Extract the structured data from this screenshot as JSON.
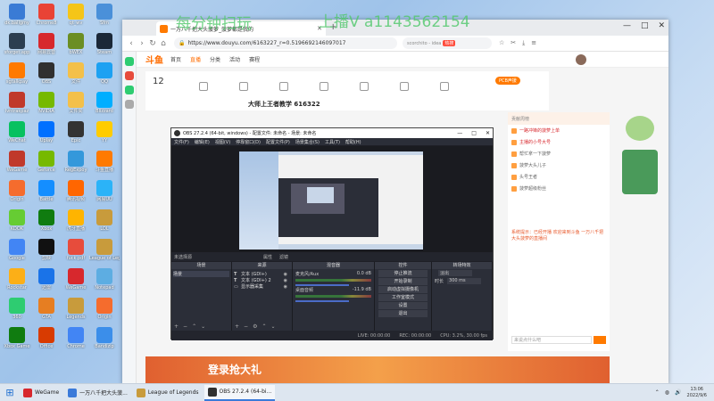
{
  "overlay": {
    "text_left": "每分钟扫玩",
    "text_right": "上播V a1143562154"
  },
  "desktop_icons": [
    {
      "label": "dk.ballgmy",
      "color": "#3a7bd5"
    },
    {
      "label": "Chrome8",
      "color": "#e94335"
    },
    {
      "label": "qt_wv",
      "color": "#f5c518"
    },
    {
      "label": "Sfm",
      "color": "#4a90d9"
    },
    {
      "label": "sforget.app",
      "color": "#2c3e50"
    },
    {
      "label": "网易云音",
      "color": "#d7282d"
    },
    {
      "label": "bWEX",
      "color": "#6b8e23"
    },
    {
      "label": "Steam",
      "color": "#1b2838"
    },
    {
      "label": "sgtalkpay",
      "color": "#ff7a00"
    },
    {
      "label": "OBS",
      "color": "#303030"
    },
    {
      "label": "文件",
      "color": "#f3c04a"
    },
    {
      "label": "QQ",
      "color": "#1da1f2"
    },
    {
      "label": "lvntrakpaz",
      "color": "#c0392b"
    },
    {
      "label": "NVIDIA",
      "color": "#76b900"
    },
    {
      "label": "文件夹",
      "color": "#f3c04a"
    },
    {
      "label": "Blizzard",
      "color": "#00aeff"
    },
    {
      "label": "WeChat",
      "color": "#07c160"
    },
    {
      "label": "Uplay",
      "color": "#0070ff"
    },
    {
      "label": "Epic",
      "color": "#333333"
    },
    {
      "label": "YY",
      "color": "#ffcc00"
    },
    {
      "label": "WeGame",
      "color": "#c0392b"
    },
    {
      "label": "Geforce",
      "color": "#76b900"
    },
    {
      "label": "RegExpoy",
      "color": "#3498db"
    },
    {
      "label": "斗鱼直播",
      "color": "#ff7a00"
    },
    {
      "label": "Origin",
      "color": "#f56c2d"
    },
    {
      "label": "Battle",
      "color": "#148eff"
    },
    {
      "label": "腾讯视频",
      "color": "#ff6600"
    },
    {
      "label": "网易UU",
      "color": "#2bb3f8"
    },
    {
      "label": "KOOK",
      "color": "#66cc33"
    },
    {
      "label": "Xbox",
      "color": "#107c10"
    },
    {
      "label": "虎牙直播",
      "color": "#ffb400"
    },
    {
      "label": "LOL",
      "color": "#c89b3c"
    },
    {
      "label": "Google",
      "color": "#4285f4"
    },
    {
      "label": "剪映",
      "color": "#111111"
    },
    {
      "label": "fuck.pdf",
      "color": "#e74c3c"
    },
    {
      "label": "League of Legends",
      "color": "#c89b3c"
    },
    {
      "label": "Rockstar",
      "color": "#fcaf17"
    },
    {
      "label": "迅雷",
      "color": "#1a73e8"
    },
    {
      "label": "WeGame",
      "color": "#d7282d"
    },
    {
      "label": "Notepad",
      "color": "#5dade2"
    },
    {
      "label": "360",
      "color": "#2ecc71"
    },
    {
      "label": "GTA",
      "color": "#e67e22"
    },
    {
      "label": "Legends",
      "color": "#c89b3c"
    },
    {
      "label": "Origin",
      "color": "#f56c2d"
    },
    {
      "label": "Xbox Game",
      "color": "#107c10"
    },
    {
      "label": "Office",
      "color": "#d83b01"
    },
    {
      "label": "Chrome",
      "color": "#4285f4"
    },
    {
      "label": "Bandizip",
      "color": "#3b8eea"
    }
  ],
  "browser": {
    "tab_title": "一万八千把大头菠萝_菠萝都是我的",
    "url": "https://www.douyu.com/6163227_r=0.5196692146097017",
    "search_placeholder": "scorchito - idea",
    "search_hot": "热搜",
    "nav_back": "‹",
    "nav_forward": "›",
    "nav_refresh": "↻",
    "nav_home": "⌂",
    "new_tab": "+",
    "win_min": "—",
    "win_max": "□",
    "win_close": "✕"
  },
  "douyu": {
    "logo": "斗鱼",
    "nav": [
      "首页",
      "直播",
      "分类",
      "活动",
      "赛程"
    ],
    "count": "12",
    "streamer_title": "大师上王者教学 616322",
    "pcb_button": "PCB声援",
    "right_header": "贡献周榜",
    "right_rows": [
      "一路冲锋的菠萝上单",
      "主播的小号大号",
      "帮忙拿一下菠萝",
      "菠萝大头儿子",
      "头号王者",
      "菠萝超级粉丝"
    ],
    "chat_text": "系统提示：已经开播 欢迎来到斗鱼 一万八千把大头菠萝的直播间",
    "chat_input": "来说点什么吧",
    "banner": "登录抢大礼"
  },
  "obs": {
    "title": "OBS 27.2.4 (64-bit, windows) - 配置文件: 未命名 - 场景: 未命名",
    "menu": [
      "文件(F)",
      "编辑(E)",
      "视图(V)",
      "停靠窗口(D)",
      "配置文件(P)",
      "场景集合(S)",
      "工具(T)",
      "帮助(H)"
    ],
    "source_label": "未选择源",
    "props_btn": "属性",
    "filters_btn": "滤镜",
    "dock_scenes": "场景",
    "dock_sources": "来源",
    "dock_mixer": "混音器",
    "dock_transitions": "转场特效",
    "dock_controls": "控件",
    "scene_name": "场景",
    "sources": [
      {
        "icon": "T",
        "name": "文本 (GDI+)"
      },
      {
        "icon": "T",
        "name": "文本 (GDI+) 2"
      },
      {
        "icon": "▭",
        "name": "显示器采集"
      }
    ],
    "mixer": [
      {
        "name": "麦克风/Aux",
        "db": "0.0 dB"
      },
      {
        "name": "桌面音频",
        "db": "-11.9 dB"
      }
    ],
    "transition_label": "淡出",
    "transition_duration_label": "时长",
    "transition_duration": "300 ms",
    "controls": [
      "停止推流",
      "开始录制",
      "启动虚拟摄像机",
      "工作室模式",
      "设置",
      "退出"
    ],
    "status": {
      "live": "LIVE: 00:00:00",
      "rec": "REC: 00:00:00",
      "cpu": "CPU: 3.2%, 30.00 fps"
    }
  },
  "taskbar": {
    "items": [
      {
        "label": "WeGame",
        "color": "#d7282d",
        "active": false
      },
      {
        "label": "一万八千把大头菠...",
        "color": "#3b7ad9",
        "active": false
      },
      {
        "label": "League of Legends",
        "color": "#c89b3c",
        "active": false
      },
      {
        "label": "OBS 27.2.4 (64-bi...",
        "color": "#303030",
        "active": true
      }
    ],
    "time": "13:06",
    "date": "2022/9/6"
  }
}
